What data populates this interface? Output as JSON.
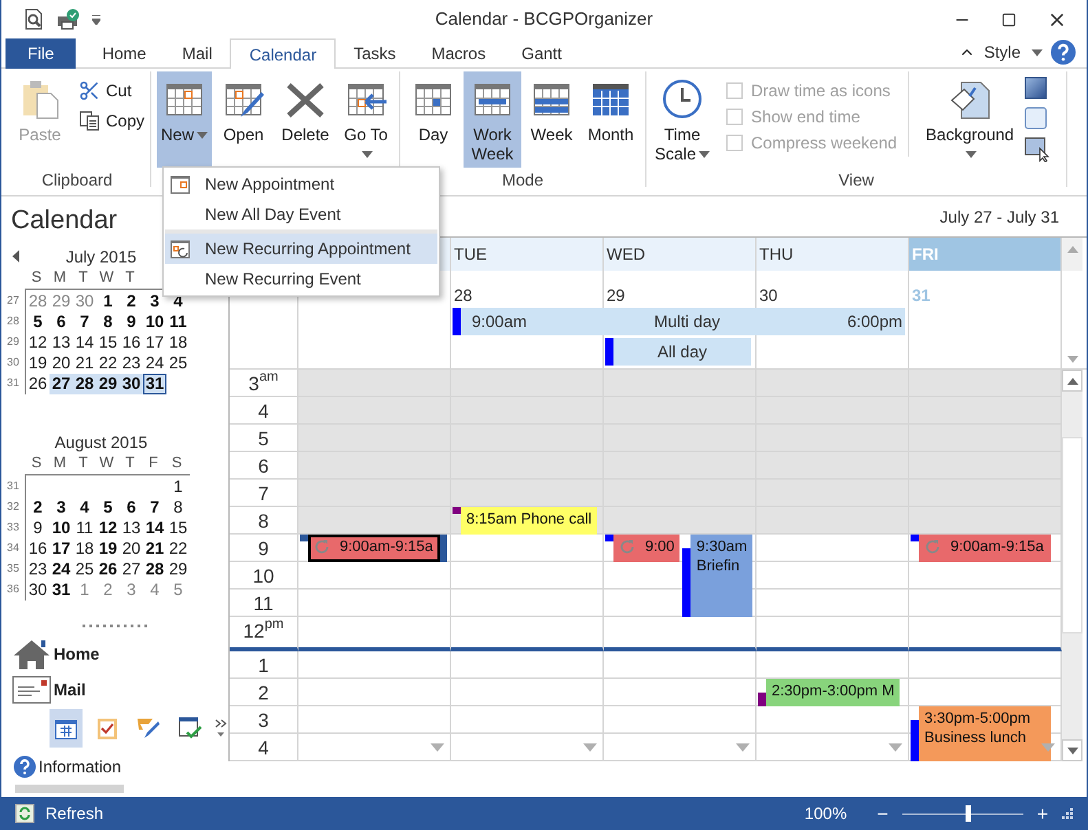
{
  "window": {
    "title": "Calendar - BCGPOrganizer"
  },
  "file_button": {
    "label": "File"
  },
  "tabs": [
    {
      "label": "Home",
      "selected": false
    },
    {
      "label": "Mail",
      "selected": false
    },
    {
      "label": "Calendar",
      "selected": true
    },
    {
      "label": "Tasks",
      "selected": false
    },
    {
      "label": "Macros",
      "selected": false
    },
    {
      "label": "Gantt",
      "selected": false
    }
  ],
  "style_menu": {
    "label": "Style"
  },
  "ribbon": {
    "groups": [
      {
        "label": "Clipboard",
        "large": [
          {
            "label": "Paste",
            "kind": "paste",
            "selected": false,
            "disabled": true,
            "dropdown": false
          }
        ],
        "small": [
          {
            "label": "Cut",
            "kind": "cut"
          },
          {
            "label": "Copy",
            "kind": "copy"
          }
        ]
      },
      {
        "large": [
          {
            "label": "New",
            "kind": "new",
            "selected": true,
            "disabled": false,
            "dropdown": true
          },
          {
            "label": "Open",
            "kind": "open",
            "selected": false,
            "disabled": false,
            "dropdown": false
          },
          {
            "label": "Delete",
            "kind": "delete",
            "selected": false,
            "disabled": false,
            "dropdown": false
          },
          {
            "label": "Go To",
            "kind": "goto",
            "selected": false,
            "disabled": false,
            "dropdown": true
          }
        ]
      },
      {
        "label": "Mode",
        "large": [
          {
            "label": "Day",
            "kind": "day",
            "selected": false,
            "disabled": false,
            "dropdown": false
          },
          {
            "label": "Work Week",
            "kind": "workweek",
            "selected": true,
            "disabled": false,
            "dropdown": false
          },
          {
            "label": "Week",
            "kind": "week",
            "selected": false,
            "disabled": false,
            "dropdown": false
          },
          {
            "label": "Month",
            "kind": "month",
            "selected": false,
            "disabled": false,
            "dropdown": false
          }
        ]
      },
      {
        "label": "View",
        "large": [
          {
            "label": "Time Scale",
            "kind": "timescale",
            "selected": false,
            "disabled": false,
            "dropdown": true
          }
        ],
        "checks": [
          {
            "label": "Draw time as icons",
            "checked": false,
            "disabled": true
          },
          {
            "label": "Show end time",
            "checked": false,
            "disabled": true
          },
          {
            "label": "Compress weekend",
            "checked": false,
            "disabled": true
          }
        ],
        "extra": [
          {
            "label": "Background",
            "kind": "background",
            "selected": false,
            "disabled": false,
            "dropdown": true
          }
        ]
      }
    ]
  },
  "new_menu": [
    {
      "label": "New Appointment",
      "kind": "appointment",
      "selected": false,
      "divider": false
    },
    {
      "label": "New All Day Event",
      "kind": "event",
      "selected": false,
      "divider": false
    },
    {
      "label": "New Recurring Appointment",
      "kind": "recurring",
      "selected": true,
      "divider": true
    },
    {
      "label": "New Recurring Event",
      "kind": "event",
      "selected": false,
      "divider": false
    }
  ],
  "sidebar": {
    "title": "Calendar",
    "months": [
      {
        "title": "July 2015",
        "arrow": true,
        "headers": [
          "S",
          "M",
          "T",
          "W",
          "T"
        ],
        "weeks": [
          {
            "no": "27",
            "days": [
              {
                "t": "28",
                "kind": "other"
              },
              {
                "t": "29",
                "kind": "other"
              },
              {
                "t": "30",
                "kind": "other"
              },
              {
                "t": "1",
                "kind": "busy"
              },
              {
                "t": "2",
                "kind": "busy"
              },
              {
                "t": "3",
                "kind": "busy"
              },
              {
                "t": "4",
                "kind": "busy"
              }
            ]
          },
          {
            "no": "28",
            "days": [
              {
                "t": "5",
                "kind": "busy"
              },
              {
                "t": "6",
                "kind": "busy"
              },
              {
                "t": "7",
                "kind": "busy"
              },
              {
                "t": "8",
                "kind": "busy"
              },
              {
                "t": "9",
                "kind": "busy"
              },
              {
                "t": "10",
                "kind": "busy"
              },
              {
                "t": "11",
                "kind": "busy"
              }
            ]
          },
          {
            "no": "29",
            "days": [
              {
                "t": "12",
                "kind": "plain"
              },
              {
                "t": "13",
                "kind": "plain"
              },
              {
                "t": "14",
                "kind": "plain"
              },
              {
                "t": "15",
                "kind": "plain"
              },
              {
                "t": "16",
                "kind": "plain"
              },
              {
                "t": "17",
                "kind": "plain"
              },
              {
                "t": "18",
                "kind": "plain"
              }
            ]
          },
          {
            "no": "30",
            "days": [
              {
                "t": "19",
                "kind": "plain"
              },
              {
                "t": "20",
                "kind": "plain"
              },
              {
                "t": "21",
                "kind": "plain"
              },
              {
                "t": "22",
                "kind": "plain"
              },
              {
                "t": "23",
                "kind": "plain"
              },
              {
                "t": "24",
                "kind": "plain"
              },
              {
                "t": "25",
                "kind": "plain"
              }
            ]
          },
          {
            "no": "31",
            "days": [
              {
                "t": "26",
                "kind": "plain"
              },
              {
                "t": "27",
                "kind": "range"
              },
              {
                "t": "28",
                "kind": "range"
              },
              {
                "t": "29",
                "kind": "range"
              },
              {
                "t": "30",
                "kind": "range"
              },
              {
                "t": "31",
                "kind": "today"
              },
              {
                "kind": "blank"
              }
            ]
          }
        ]
      },
      {
        "title": "August 2015",
        "arrow": false,
        "headers": [
          "S",
          "M",
          "T",
          "W",
          "T",
          "F",
          "S"
        ],
        "weeks": [
          {
            "no": "31",
            "days": [
              {
                "kind": "blank"
              },
              {
                "kind": "blank"
              },
              {
                "kind": "blank"
              },
              {
                "kind": "blank"
              },
              {
                "kind": "blank"
              },
              {
                "kind": "blank"
              },
              {
                "t": "1",
                "kind": "plain"
              }
            ]
          },
          {
            "no": "32",
            "days": [
              {
                "t": "2",
                "kind": "busy"
              },
              {
                "t": "3",
                "kind": "busy"
              },
              {
                "t": "4",
                "kind": "busy"
              },
              {
                "t": "5",
                "kind": "busy"
              },
              {
                "t": "6",
                "kind": "busy"
              },
              {
                "t": "7",
                "kind": "busy"
              },
              {
                "t": "8",
                "kind": "plain"
              }
            ]
          },
          {
            "no": "33",
            "days": [
              {
                "t": "9",
                "kind": "plain"
              },
              {
                "t": "10",
                "kind": "busy"
              },
              {
                "t": "11",
                "kind": "plain"
              },
              {
                "t": "12",
                "kind": "busy"
              },
              {
                "t": "13",
                "kind": "plain"
              },
              {
                "t": "14",
                "kind": "busy"
              },
              {
                "t": "15",
                "kind": "plain"
              }
            ]
          },
          {
            "no": "34",
            "days": [
              {
                "t": "16",
                "kind": "plain"
              },
              {
                "t": "17",
                "kind": "busy"
              },
              {
                "t": "18",
                "kind": "plain"
              },
              {
                "t": "19",
                "kind": "busy"
              },
              {
                "t": "20",
                "kind": "plain"
              },
              {
                "t": "21",
                "kind": "busy"
              },
              {
                "t": "22",
                "kind": "plain"
              }
            ]
          },
          {
            "no": "35",
            "days": [
              {
                "t": "23",
                "kind": "plain"
              },
              {
                "t": "24",
                "kind": "busy"
              },
              {
                "t": "25",
                "kind": "plain"
              },
              {
                "t": "26",
                "kind": "busy"
              },
              {
                "t": "27",
                "kind": "plain"
              },
              {
                "t": "28",
                "kind": "busy"
              },
              {
                "t": "29",
                "kind": "plain"
              }
            ]
          },
          {
            "no": "36",
            "days": [
              {
                "t": "30",
                "kind": "plain"
              },
              {
                "t": "31",
                "kind": "busy"
              },
              {
                "t": "1",
                "kind": "other"
              },
              {
                "t": "2",
                "kind": "other"
              },
              {
                "t": "3",
                "kind": "other"
              },
              {
                "t": "4",
                "kind": "other"
              },
              {
                "t": "5",
                "kind": "other"
              }
            ]
          }
        ]
      }
    ],
    "nav": [
      {
        "label": "Home",
        "kind": "home"
      },
      {
        "label": "Mail",
        "kind": "mail"
      }
    ],
    "shortcuts": [
      {
        "kind": "calendar",
        "selected": true
      },
      {
        "kind": "tasks",
        "selected": false
      },
      {
        "kind": "notes",
        "selected": false
      },
      {
        "kind": "planner",
        "selected": false
      }
    ],
    "info": {
      "label": "Information"
    }
  },
  "range": "July 27 - July 31",
  "days": [
    {
      "today": false,
      "more": true
    },
    {
      "name": "TUE",
      "date": "28",
      "today": false,
      "more": true,
      "all_day": [
        {
          "kind": "multi",
          "start": "9:00am",
          "title": "Multi day",
          "end": "6:00pm",
          "color": "#cde3f5",
          "marker": {
            "color": "#0000ff"
          }
        }
      ]
    },
    {
      "name": "WED",
      "date": "29",
      "today": false,
      "more": true,
      "all_day": [
        {
          "kind": "single",
          "title": "All day",
          "color": "#cde3f5",
          "marker": {
            "color": "#0000ff"
          }
        }
      ]
    },
    {
      "name": "THU",
      "date": "30",
      "today": false,
      "more": true
    },
    {
      "name": "FRI",
      "date": "31",
      "today": true,
      "more": true
    }
  ],
  "hours": [
    {
      "label": "3",
      "suffix": "am",
      "working": false,
      "divider": false
    },
    {
      "label": "4",
      "working": false,
      "divider": false
    },
    {
      "label": "5",
      "working": false,
      "divider": false
    },
    {
      "label": "6",
      "working": false,
      "divider": false
    },
    {
      "label": "7",
      "working": false,
      "divider": false
    },
    {
      "label": "8",
      "working": false,
      "divider": false,
      "cells": [
        [],
        [
          {
            "lines": [
              "8:15am Phone call"
            ],
            "color": "#ffff66",
            "marker": {
              "color": "#800080"
            },
            "kind": "short",
            "late": false,
            "recurring": false,
            "selected": false
          }
        ],
        [],
        [],
        []
      ]
    },
    {
      "label": "9",
      "working": true,
      "divider": false,
      "cells": [
        [
          {
            "lines": [
              "9:00am-9:15a"
            ],
            "color": "#e8696b",
            "marker": {
              "color": "#2b579a"
            },
            "kind": "short",
            "late": false,
            "recurring": true,
            "selected": true
          }
        ],
        [],
        [
          {
            "lines": [
              "9:00"
            ],
            "color": "#e8696b",
            "marker": {
              "color": "#0000ff"
            },
            "kind": "short",
            "late": false,
            "recurring": true,
            "selected": false
          },
          {
            "lines": [
              "9:30am",
              "Briefin"
            ],
            "color": "#7aa0dc",
            "marker": {
              "color": "#0000ff"
            },
            "kind": "long",
            "late": true,
            "recurring": false,
            "selected": false
          }
        ],
        [],
        [
          {
            "lines": [
              "9:00am-9:15a"
            ],
            "color": "#e8696b",
            "marker": {
              "color": "#0000ff"
            },
            "kind": "short",
            "late": false,
            "recurring": true,
            "selected": false
          }
        ]
      ]
    },
    {
      "label": "10",
      "working": true,
      "divider": false
    },
    {
      "label": "11",
      "working": true,
      "divider": false
    },
    {
      "label": "12",
      "suffix": "pm",
      "working": true,
      "divider": true
    },
    {
      "label": "1",
      "working": true,
      "divider": false
    },
    {
      "label": "2",
      "working": true,
      "divider": false,
      "cells": [
        [],
        [],
        [],
        [
          {
            "lines": [
              "2:30pm-3:00pm M"
            ],
            "color": "#88d47c",
            "marker": {
              "color": "#800080"
            },
            "kind": "short",
            "late": true,
            "recurring": false,
            "selected": false
          }
        ],
        []
      ]
    },
    {
      "label": "3",
      "working": true,
      "divider": false,
      "cells": [
        [],
        [],
        [],
        [],
        [
          {
            "lines": [
              "3:30pm-5:00pm",
              "Business lunch"
            ],
            "color": "#f4995a",
            "marker": {
              "color": "#0000ff"
            },
            "kind": "medium",
            "late": true,
            "recurring": false,
            "selected": false
          }
        ]
      ]
    },
    {
      "label": "4",
      "working": true,
      "divider": false
    }
  ],
  "status_bar": {
    "action": "Refresh",
    "zoom": "100%",
    "zoom_out": "−",
    "zoom_in": "+",
    "level": 0.55
  }
}
